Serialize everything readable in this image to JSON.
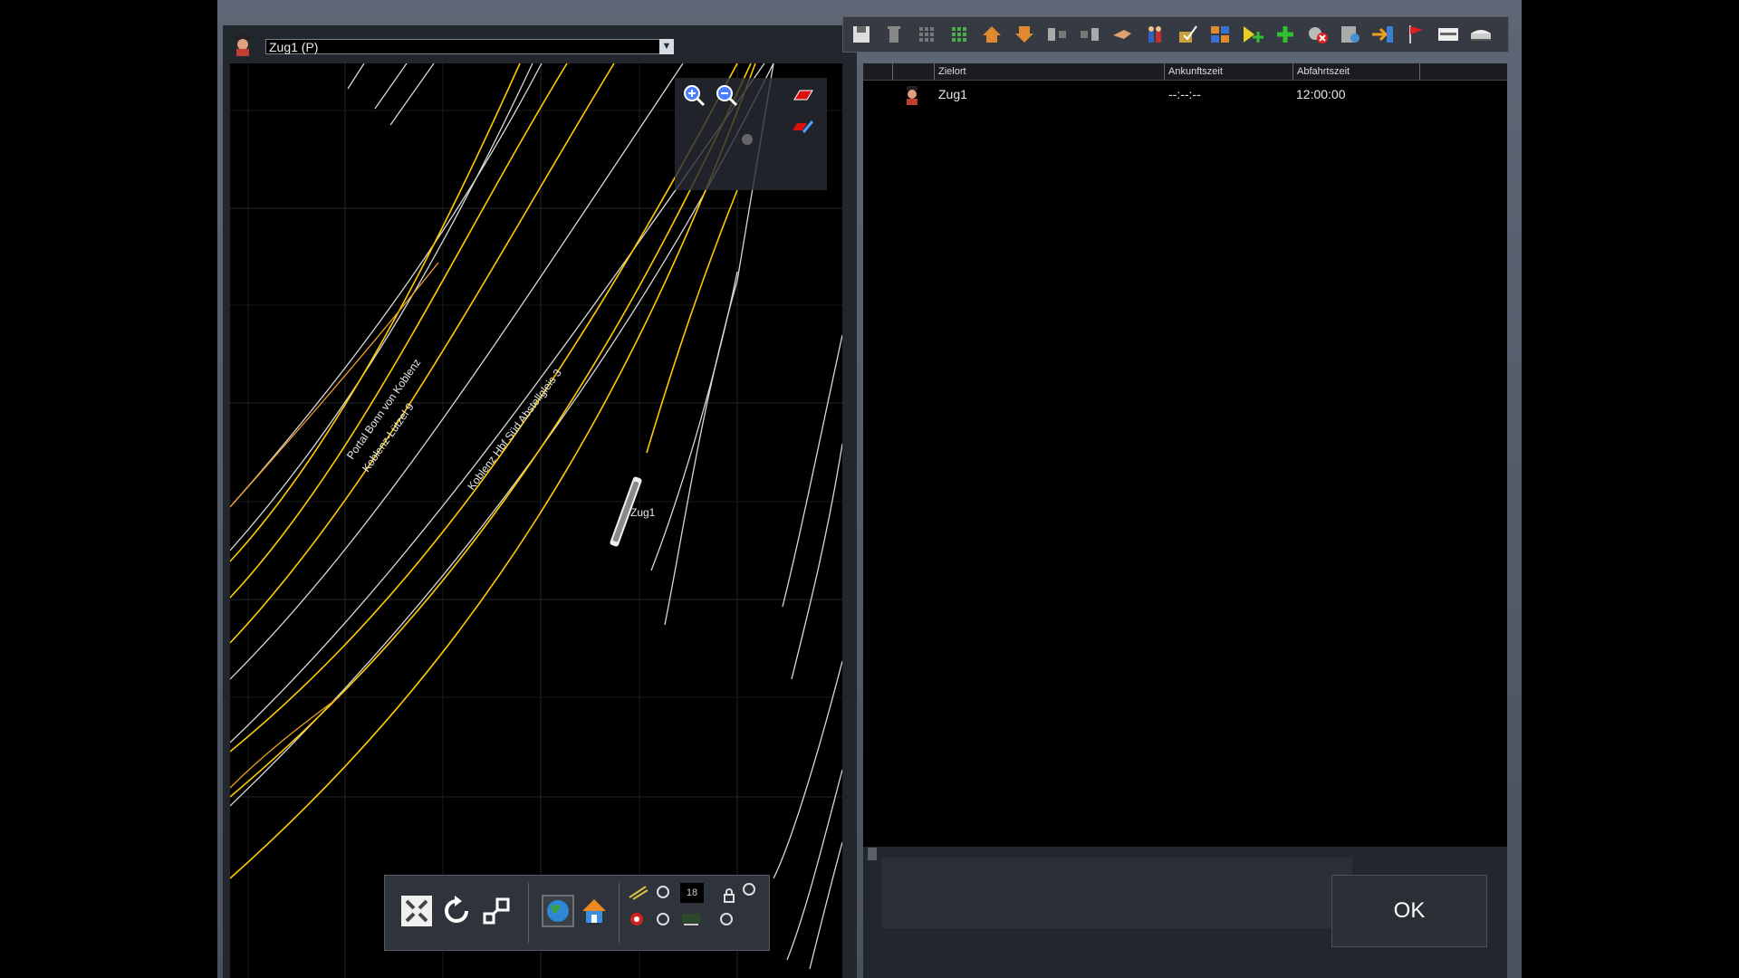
{
  "train_selector": {
    "selected": "Zug1 (P)"
  },
  "map": {
    "labels": {
      "portal": "Portal Bonn von Koblenz",
      "luetzel": "Koblenz-Lützel 9",
      "hbf": "Koblenz Hbf Süd Abstellgleis 3",
      "train": "Zug1"
    }
  },
  "map_toolbar": {
    "number": "18"
  },
  "top_toolbar": {
    "icons": [
      "save-icon",
      "delete-icon",
      "grid-icon",
      "grid-green-icon",
      "move-up-icon",
      "move-down-icon",
      "split-left-icon",
      "split-right-icon",
      "hand-icon",
      "passenger-icon",
      "edit-check-icon",
      "couple-icon",
      "add-yellow-icon",
      "add-green-icon",
      "remove-icon",
      "settings-icon",
      "exit-icon",
      "flag-icon",
      "display-icon",
      "train-icon"
    ]
  },
  "schedule": {
    "columns": [
      "Zielort",
      "Ankunftszeit",
      "Abfahrtszeit"
    ],
    "rows": [
      {
        "destination": "Zug1",
        "arrival": "--:--:--",
        "departure": "12:00:00"
      }
    ]
  },
  "dialog": {
    "ok_label": "OK"
  },
  "colors": {
    "track_white": "#d8d8d8",
    "track_yellow": "#ffcc00",
    "track_orange": "#f0a020"
  }
}
